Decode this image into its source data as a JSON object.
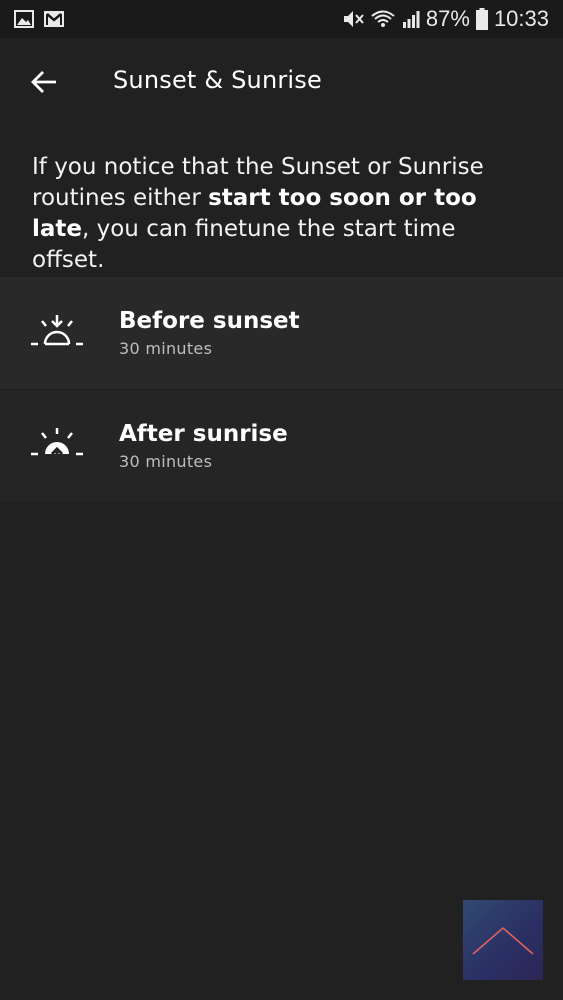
{
  "status_bar": {
    "battery_percent": "87%",
    "time": "10:33",
    "icons": [
      "image-icon",
      "gmail-icon",
      "mute-icon",
      "wifi-icon",
      "signal-icon",
      "battery-icon"
    ]
  },
  "header": {
    "title": "Sunset & Sunrise",
    "back_icon": "back-arrow-icon"
  },
  "description": {
    "part1": "If you notice that the Sunset or Sunrise routines either ",
    "bold": "start too soon or too late",
    "part2": ", you can finetune the start time offset."
  },
  "items": [
    {
      "title": "Before sunset",
      "subtitle": "30 minutes",
      "icon": "sunset-icon"
    },
    {
      "title": "After sunrise",
      "subtitle": "30 minutes",
      "icon": "sunrise-icon"
    }
  ],
  "fab": {
    "icon": "chevron-up-icon",
    "accent": "#e0615f"
  },
  "colors": {
    "background": "#212121",
    "status_bar": "#1a1a1a",
    "item_background": "#292929",
    "subtitle_text": "#bdbdbd"
  }
}
